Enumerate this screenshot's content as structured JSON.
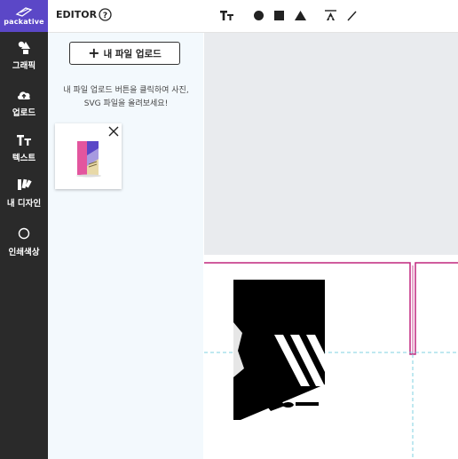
{
  "brand": {
    "name": "packative"
  },
  "sidebar": {
    "items": [
      {
        "label": "그래픽",
        "icon": "graphics-icon"
      },
      {
        "label": "업로드",
        "icon": "upload-cloud-icon"
      },
      {
        "label": "텍스트",
        "icon": "text-icon"
      },
      {
        "label": "내 디자인",
        "icon": "my-design-icon"
      },
      {
        "label": "인쇄색상",
        "icon": "print-color-icon"
      }
    ]
  },
  "header": {
    "title": "EDITOR",
    "help_glyph": "?",
    "tools": [
      "text-tool-icon",
      "circle-tool-icon",
      "square-tool-icon",
      "triangle-tool-icon",
      "align-tool-icon",
      "line-tool-icon"
    ]
  },
  "upload_panel": {
    "button_label": "내 파일 업로드",
    "hint_line1": "내 파일 업로드 버튼을 클릭하여 사진,",
    "hint_line2": "SVG 파일을 올려보세요!"
  },
  "colors": {
    "brand": "#5b47c7",
    "rail": "#2a2a2a",
    "panel": "#f3f9fd",
    "dieline": "#c0267e",
    "guide": "#7fd0e0",
    "workspace": "#e9ebee"
  }
}
